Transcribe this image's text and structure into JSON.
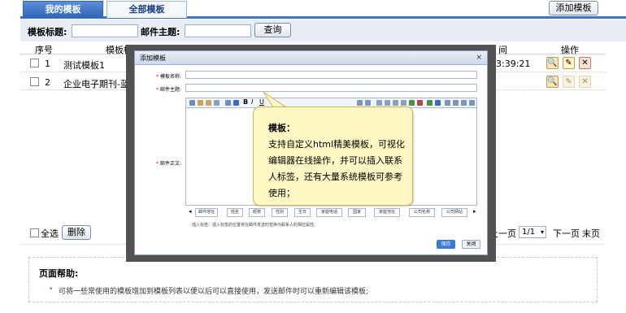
{
  "tabs": {
    "mine": "我的模板",
    "all": "全部模板"
  },
  "add_template_button": "添加模板",
  "search": {
    "title_label": "模板标题:",
    "subject_label": "邮件主题:",
    "query_button": "查询"
  },
  "table": {
    "headers": {
      "index": "序号",
      "title": "模板标题",
      "time": "间",
      "ops": "操作"
    },
    "rows": [
      {
        "index": "1",
        "title": "测试模板1",
        "time": "3:39:21"
      },
      {
        "index": "2",
        "title": "企业电子期刊-蓝色",
        "time": ""
      }
    ]
  },
  "footer": {
    "select_all": "全选",
    "delete_button": "删除",
    "prev_page": "上一页",
    "page_select": "1/1",
    "next_page": "下一页",
    "last_page": "末页"
  },
  "help": {
    "title": "页面帮助:",
    "item": "可将一些常使用的模板增加到模板列表以便以后可以直接使用，发送邮件时可以重新编辑该模板;"
  },
  "modal": {
    "title": "添加模板",
    "close_glyph": "×",
    "name_label": "模板名称:",
    "subject_label": "邮件主题:",
    "body_label": "邮件正文:",
    "tags": [
      "邮件地址",
      "姓名",
      "昵称",
      "性别",
      "生日",
      "家庭电话",
      "国家",
      "家庭地址",
      "公司名称",
      "公司网站"
    ],
    "hint": "插入标签：插入标签的位置将在邮件发送时替换为联系人的相应属性;",
    "save_button": "保存",
    "close_button": "关闭"
  },
  "tooltip": {
    "title": "模板：",
    "body": "支持自定义html精美模板，可视化编辑器在线操作，并可以插入联系人标签，还有大量系统模板可参考使用；"
  },
  "colors": {
    "accent": "#3f74c4",
    "tooltip_bg": "#fff8c4",
    "shadow": "#525252"
  }
}
